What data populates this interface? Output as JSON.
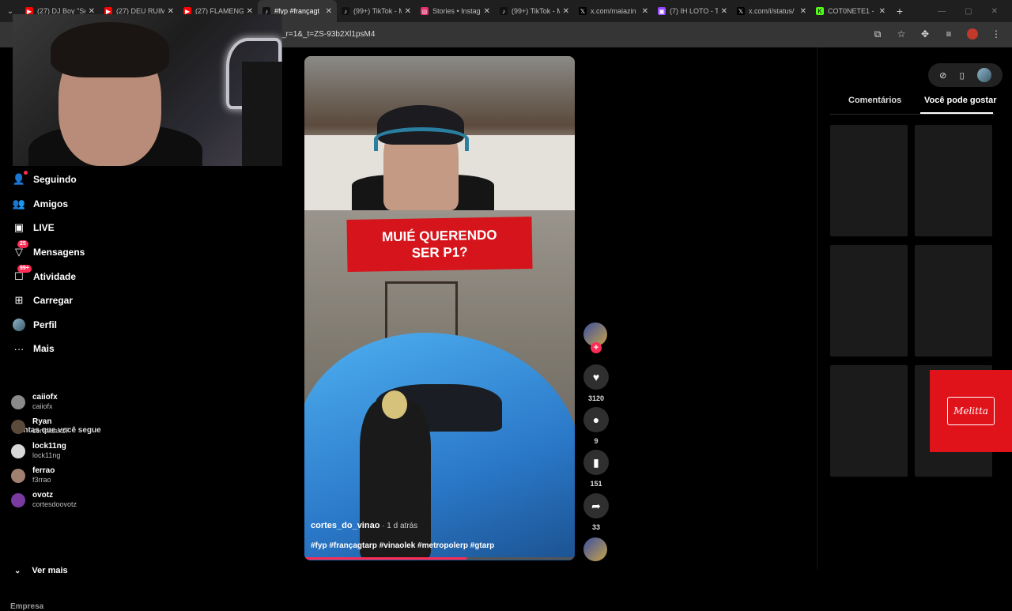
{
  "browser": {
    "tabs": [
      {
        "title": "(27) DJ Boy \"Se",
        "fav": "yt"
      },
      {
        "title": "(27) DEU RUIM",
        "fav": "yt"
      },
      {
        "title": "(27) FLAMENG",
        "fav": "yt"
      },
      {
        "title": "#fyp #françagt",
        "fav": "tt",
        "active": true
      },
      {
        "title": "(99+) TikTok - M",
        "fav": "tt"
      },
      {
        "title": "Stories • Instag",
        "fav": "ig"
      },
      {
        "title": "(99+) TikTok - M",
        "fav": "tt"
      },
      {
        "title": "x.com/maiazin",
        "fav": "x"
      },
      {
        "title": "(7) IH LOTO - T",
        "fav": "tw"
      },
      {
        "title": "x.com/i/status/",
        "fav": "x"
      },
      {
        "title": "COT0NETE1 - V",
        "fav": "kick"
      }
    ],
    "url": "_r=1&_t=ZS-93b2Xl1psM4"
  },
  "sidebar": {
    "nav": [
      {
        "label": "Seguindo",
        "icon": "person-follow-icon"
      },
      {
        "label": "Amigos",
        "icon": "friends-icon"
      },
      {
        "label": "LIVE",
        "icon": "live-icon"
      },
      {
        "label": "Mensagens",
        "icon": "messages-icon",
        "badge": "25"
      },
      {
        "label": "Atividade",
        "icon": "activity-icon",
        "badge": "99+"
      },
      {
        "label": "Carregar",
        "icon": "upload-icon"
      },
      {
        "label": "Perfil",
        "icon": "profile-icon"
      },
      {
        "label": "Mais",
        "icon": "more-icon"
      }
    ],
    "following_title": "Contas que você segue",
    "accounts": [
      {
        "name": "caiiofx",
        "handle": "caiiofx",
        "color": "#8a8a8a"
      },
      {
        "name": "Ryan",
        "handle": "corteluanz7",
        "color": "#5a4a3a"
      },
      {
        "name": "lock11ng",
        "handle": "lock11ng",
        "color": "#d8d8d8"
      },
      {
        "name": "ferrao",
        "handle": "f3rrao",
        "color": "#a08070"
      },
      {
        "name": "ovotz",
        "handle": "cortesdoovotz",
        "color": "#7a3aa0"
      }
    ],
    "see_more": "Ver mais",
    "footer": "Empresa"
  },
  "video": {
    "title_line1": "MUIÉ QUERENDO",
    "title_line2": "SER P1?",
    "author": "cortes_do_vinao",
    "time": " · 1 d atrás",
    "tags": "#fyp #françagtarp #vinaolek #metropolerp #gtarp",
    "progress": 0.6
  },
  "actions": {
    "likes": "3120",
    "comments": "9",
    "saves": "151",
    "shares": "33"
  },
  "rightpanel": {
    "tab_comments": "Comentários",
    "tab_suggested": "Você pode gostar",
    "ad_brand": "Melitta"
  }
}
